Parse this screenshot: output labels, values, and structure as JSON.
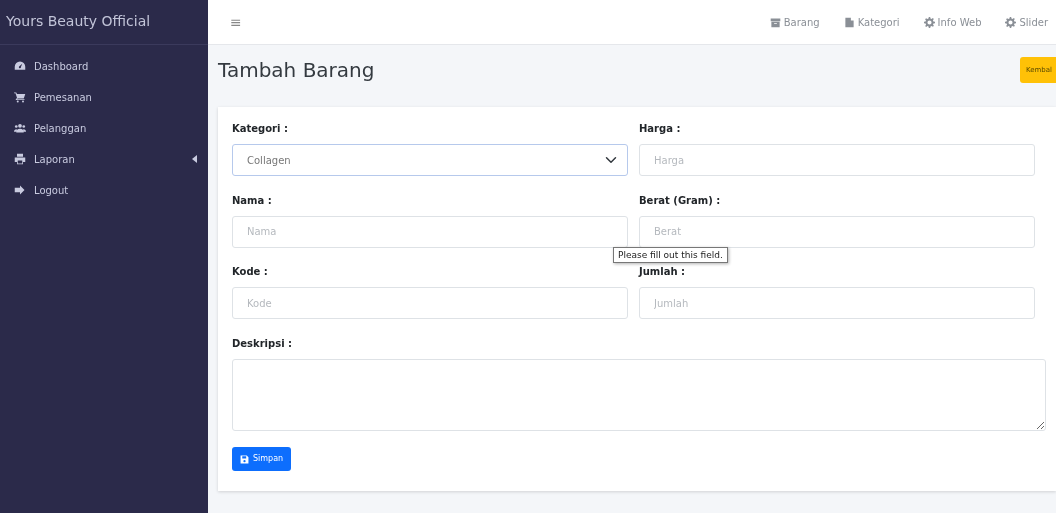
{
  "sidebar": {
    "brand": "Yours Beauty Official",
    "items": [
      {
        "label": "Dashboard"
      },
      {
        "label": "Pemesanan"
      },
      {
        "label": "Pelanggan"
      },
      {
        "label": "Laporan",
        "expanded": false
      },
      {
        "label": "Logout"
      }
    ]
  },
  "topbar": {
    "menu_icon": "≡",
    "links": [
      {
        "label": "Barang"
      },
      {
        "label": "Kategori"
      },
      {
        "label": "Info Web"
      },
      {
        "label": "Slider"
      }
    ]
  },
  "page": {
    "title": "Tambah Barang",
    "back_button": "Kembal"
  },
  "form": {
    "fields": [
      {
        "kind": "select",
        "label": "Kategori :",
        "value": "Collagen"
      },
      {
        "kind": "input",
        "label": "Harga :",
        "placeholder": "Harga"
      },
      {
        "kind": "input",
        "label": "Nama :",
        "placeholder": "Nama"
      },
      {
        "kind": "input",
        "label": "Berat (Gram) :",
        "placeholder": "Berat",
        "validation_message": "Please fill out this field."
      },
      {
        "kind": "input",
        "label": "Kode :",
        "placeholder": "Kode"
      },
      {
        "kind": "input",
        "label": "Jumlah :",
        "placeholder": "Jumlah"
      },
      {
        "kind": "textarea",
        "label": "Deskripsi :"
      }
    ],
    "submit": "Simpan"
  }
}
